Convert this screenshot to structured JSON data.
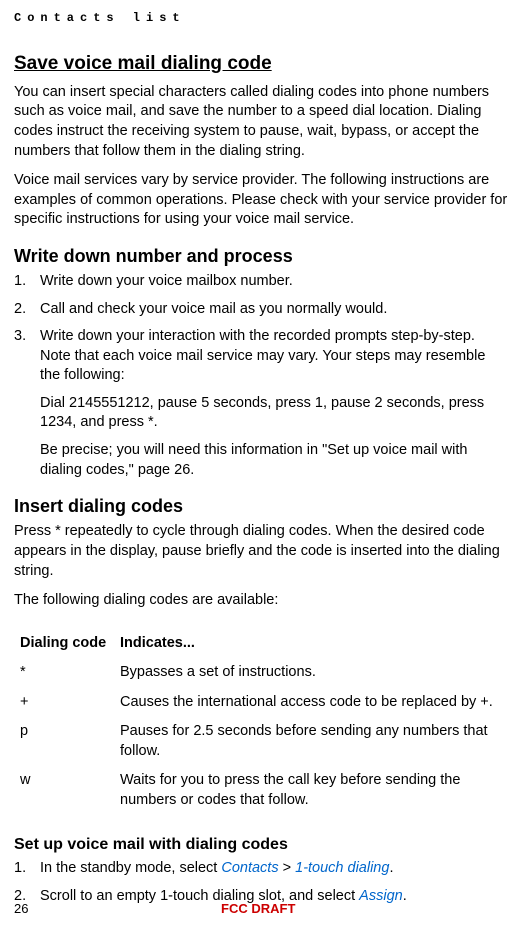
{
  "header": {
    "running": "Contacts list"
  },
  "main": {
    "title": "Save voice mail dialing code",
    "intro1": "You can insert special characters called dialing codes into phone numbers such as voice mail, and save the number to a speed dial location. Dialing codes instruct the receiving system to pause, wait, bypass, or accept the numbers that follow them in the dialing string.",
    "intro2": "Voice mail services vary by service provider. The following instructions are examples of common operations. Please check with your service provider for specific instructions for using your voice mail service.",
    "section1": {
      "heading": "Write down number and process",
      "steps": {
        "n1": "1.",
        "t1": "Write down your voice mailbox number.",
        "n2": "2.",
        "t2": "Call and check your voice mail as you normally would.",
        "n3": "3.",
        "t3a": "Write down your interaction with the recorded prompts step-by-step. Note that each voice mail service may vary. Your steps may resemble the following:",
        "t3b": "Dial 2145551212, pause 5 seconds, press 1, pause 2 seconds, press 1234, and press *.",
        "t3c": "Be precise; you will need this information in \"Set up voice mail with dialing codes,\" page 26."
      }
    },
    "section2": {
      "heading": "Insert dialing codes",
      "p1": "Press * repeatedly to cycle through dialing codes. When the desired code appears in the display, pause briefly and the code is inserted into the dialing string.",
      "p2": "The following dialing codes are available:",
      "table": {
        "h_code": "Dialing code",
        "h_desc": "Indicates...",
        "rows": [
          {
            "code": "*",
            "desc": "Bypasses a set of instructions."
          },
          {
            "code": "+",
            "desc": "Causes the international access code to be replaced by +."
          },
          {
            "code": "p",
            "desc": "Pauses for 2.5 seconds before sending any numbers that follow."
          },
          {
            "code": "w",
            "desc": "Waits for you to press the call key before sending the numbers or codes that follow."
          }
        ]
      }
    },
    "section3": {
      "heading": "Set up voice mail with dialing codes",
      "steps": {
        "n1": "1.",
        "t1_pre": "In the standby mode, select ",
        "t1_link1": "Contacts",
        "t1_sep": " > ",
        "t1_link2": "1-touch dialing",
        "t1_post": ".",
        "n2": "2.",
        "t2_pre": "Scroll to an empty 1-touch dialing slot, and select ",
        "t2_link": "Assign",
        "t2_post": "."
      }
    }
  },
  "footer": {
    "page": "26",
    "fcc": "FCC DRAFT"
  }
}
